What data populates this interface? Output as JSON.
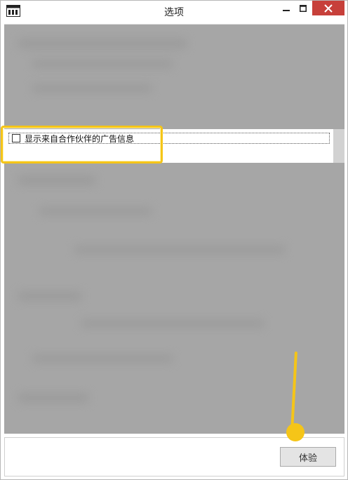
{
  "window": {
    "title": "选项",
    "icon": "app-window-icon"
  },
  "controls": {
    "minimize_icon": "minimize-icon",
    "maximize_icon": "maximize-icon",
    "close_icon": "close-icon",
    "close_color": "#c7403a"
  },
  "option": {
    "label": "显示来自合作伙伴的广告信息",
    "checked": false
  },
  "footer": {
    "ok_label": "体验"
  },
  "colors": {
    "highlight": "#f5c518",
    "blur_bg": "#a6a6a6"
  }
}
